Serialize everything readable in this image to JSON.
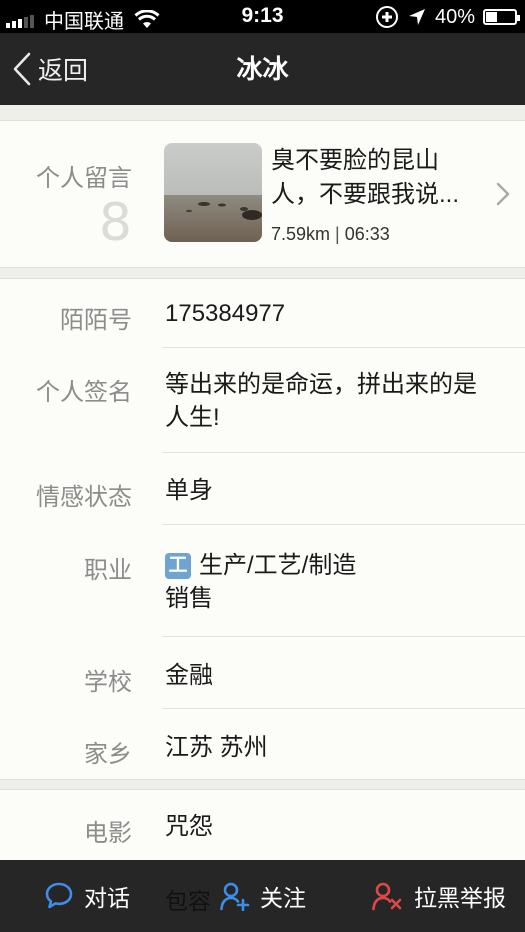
{
  "status": {
    "carrier": "中国联通",
    "time": "9:13",
    "battery": "40%",
    "battery_level": 0.4
  },
  "nav": {
    "back_label": "返回",
    "title": "冰冰"
  },
  "message": {
    "label": "个人留言",
    "count": "8",
    "text": "臭不要脸的昆山人，不要跟我说...",
    "distance": "7.59km",
    "time": "06:33"
  },
  "profile": {
    "momo_label": "陌陌号",
    "momo_value": "175384977",
    "signature_label": "个人签名",
    "signature_value": "等出来的是命运，拼出来的是人生!",
    "relationship_label": "情感状态",
    "relationship_value": "单身",
    "job_label": "职业",
    "job_icon_text": "工",
    "job_value": "生产/工艺/制造",
    "job_value2": "销售",
    "school_label": "学校",
    "school_value": "金融",
    "hometown_label": "家乡",
    "hometown_value": "江苏 苏州"
  },
  "interests": {
    "movie_label": "电影",
    "movie_value": "咒怨",
    "partial_value": "包容"
  },
  "bottom": {
    "chat_label": "对话",
    "follow_label": "关注",
    "block_label": "拉黑举报",
    "chat_color": "#3d8ee8",
    "follow_color": "#3d8ee8",
    "block_color": "#e04848"
  }
}
